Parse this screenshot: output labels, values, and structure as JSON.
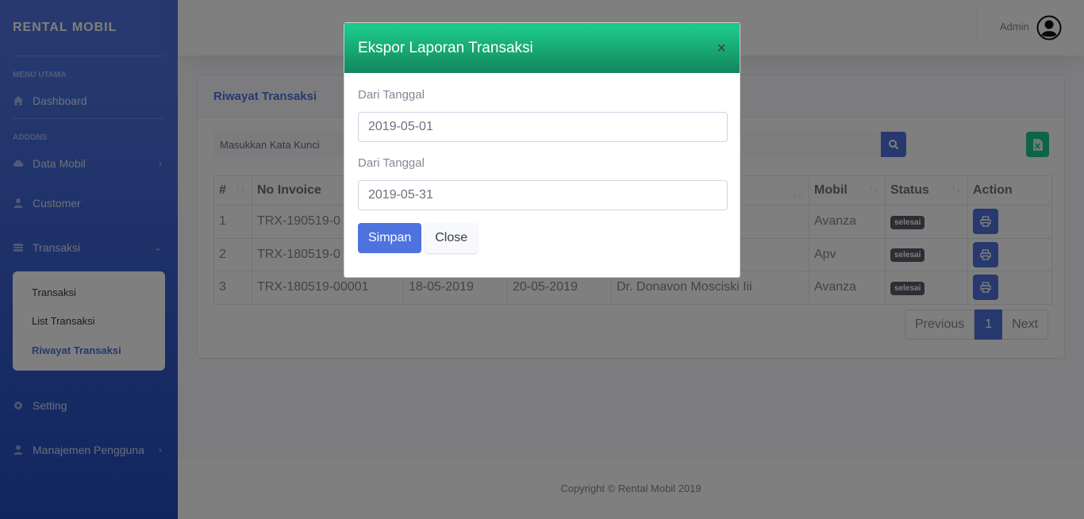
{
  "sidebar": {
    "brand": "RENTAL MOBIL",
    "heading_main": "MENU UTAMA",
    "dashboard": "Dashboard",
    "heading_addons": "ADDONS",
    "data_mobil": "Data Mobil",
    "customer": "Customer",
    "transaksi": "Transaksi",
    "submenu": [
      "Transaksi",
      "List Transaksi",
      "Riwayat Transaksi"
    ],
    "setting": "Setting",
    "manajemen": "Manajemen Pengguna"
  },
  "topbar": {
    "user": "Admin"
  },
  "card": {
    "title": "Riwayat Transaksi",
    "search_placeholder": "Masukkan Kata Kunci",
    "columns": [
      "#",
      "No Invoice",
      "",
      "",
      "",
      "Mobil",
      "Status",
      "Action"
    ],
    "rows": [
      {
        "no": "1",
        "invoice": "TRX-190519-0",
        "tgl1": "",
        "tgl2": "",
        "nama": "",
        "mobil": "Avanza",
        "status": "selesai"
      },
      {
        "no": "2",
        "invoice": "TRX-180519-0",
        "tgl1": "",
        "tgl2": "",
        "nama": "",
        "mobil": "Apv",
        "status": "selesai"
      },
      {
        "no": "3",
        "invoice": "TRX-180519-00001",
        "tgl1": "18-05-2019",
        "tgl2": "20-05-2019",
        "nama": "Dr. Donavon Mosciski Iii",
        "mobil": "Avanza",
        "status": "selesai"
      }
    ],
    "pagination": {
      "prev": "Previous",
      "page": "1",
      "next": "Next"
    }
  },
  "footer": "Copyright © Rental Mobil 2019",
  "modal": {
    "title": "Ekspor Laporan Transaksi",
    "close_symbol": "×",
    "label_from": "Dari Tanggal",
    "value_from": "2019-05-01",
    "label_to": "Dari Tanggal",
    "value_to": "2019-05-31",
    "save": "Simpan",
    "close": "Close"
  },
  "colors": {
    "primary": "#4e73df",
    "success": "#1cc88a",
    "badge": "#5a5c69"
  }
}
